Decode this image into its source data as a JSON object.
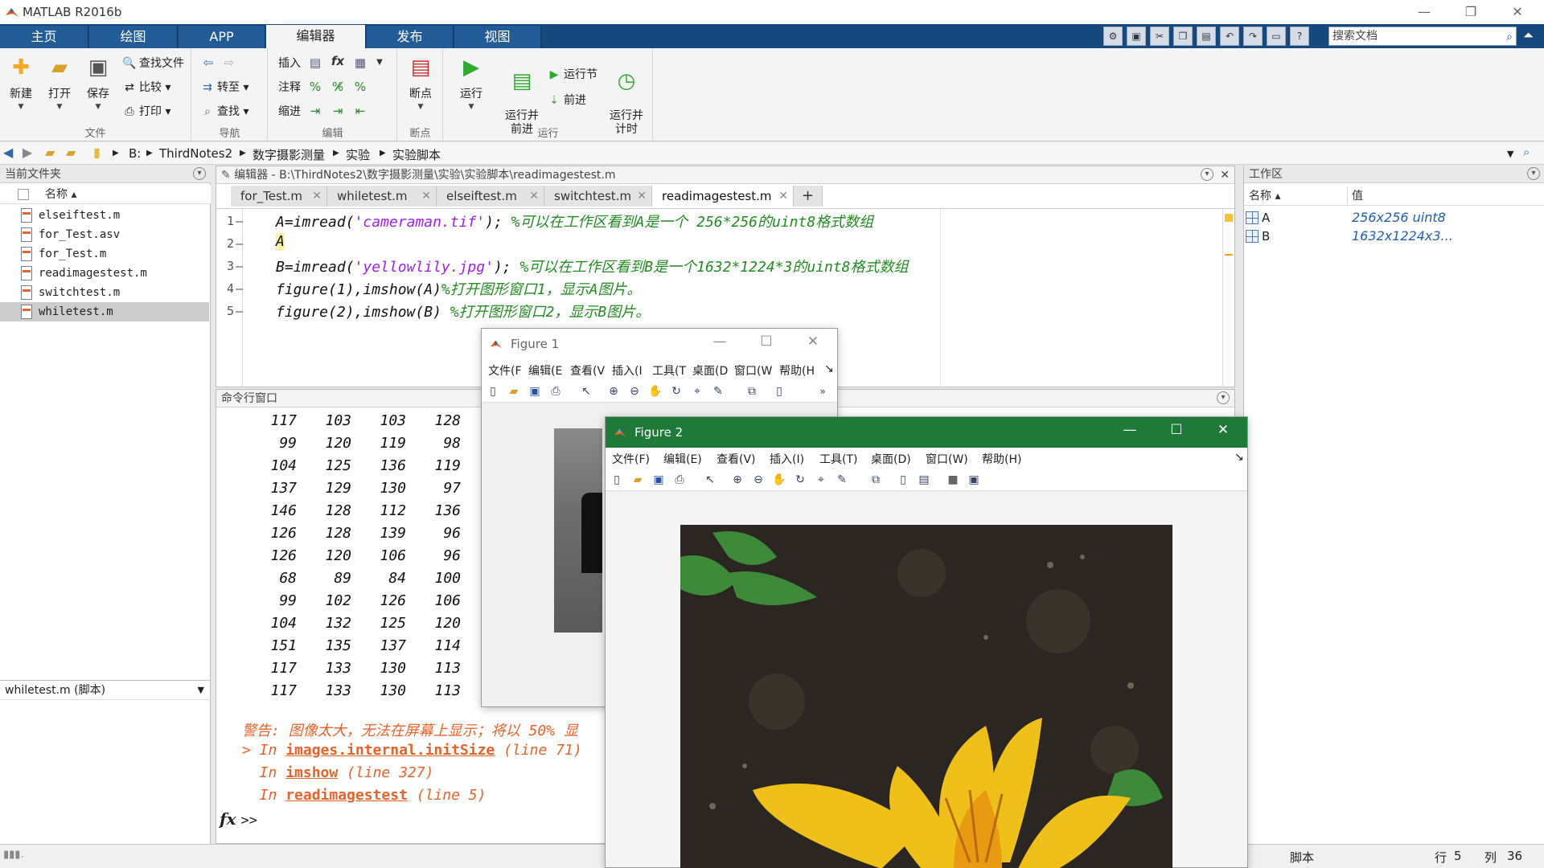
{
  "app": {
    "title": "MATLAB R2016b"
  },
  "window_controls": {
    "minimize": "—",
    "restore": "❐",
    "close": "✕"
  },
  "tabs": [
    "主页",
    "绘图",
    "APP",
    "编辑器",
    "发布",
    "视图"
  ],
  "active_tab": "编辑器",
  "search": {
    "placeholder": "搜索文档"
  },
  "ribbon": {
    "file_group": {
      "label": "文件",
      "new": "新建",
      "open": "打开",
      "save": "保存",
      "find_files": "查找文件",
      "compare": "比较",
      "print": "打印"
    },
    "nav_group": {
      "label": "导航",
      "goto": "转至",
      "find": "查找"
    },
    "edit_group": {
      "label": "编辑",
      "insert": "插入",
      "comment": "注释",
      "indent": "缩进",
      "fx": "fx"
    },
    "breakpoint_group": {
      "label": "断点",
      "breakpoints": "断点"
    },
    "run_group": {
      "label": "运行",
      "run": "运行",
      "run_advance": "运行并\n前进",
      "run_section": "运行节",
      "advance": "前进",
      "run_time": "运行并\n计时"
    }
  },
  "address": {
    "crumbs": [
      "B:",
      "ThirdNotes2",
      "数字摄影测量",
      "实验",
      "实验脚本"
    ]
  },
  "current_folder": {
    "title": "当前文件夹",
    "column": "名称 ▴",
    "files": [
      "elseiftest.m",
      "for_Test.asv",
      "for_Test.m",
      "readimagestest.m",
      "switchtest.m",
      "whiletest.m"
    ],
    "selected": "whiletest.m",
    "detail_label": "whiletest.m  (脚本)"
  },
  "editor": {
    "title": "编辑器 - B:\\ThirdNotes2\\数字摄影测量\\实验\\实验脚本\\readimagestest.m",
    "tabs": [
      "for_Test.m",
      "whiletest.m",
      "elseiftest.m",
      "switchtest.m",
      "readimagestest.m"
    ],
    "active_tab": "readimagestest.m",
    "add_tab": "+",
    "lines": [
      {
        "no": "1",
        "a": "A=imread(",
        "s": "'cameraman.tif'",
        "b": "); ",
        "c": "%可以在工作区看到A是一个 256*256的uint8格式数组"
      },
      {
        "no": "2",
        "a": "A",
        "s": "",
        "b": "",
        "c": ""
      },
      {
        "no": "3",
        "a": "B=imread(",
        "s": "'yellowlily.jpg'",
        "b": "); ",
        "c": "%可以在工作区看到B是一个1632*1224*3的uint8格式数组"
      },
      {
        "no": "4",
        "a": "figure(1),imshow(A)",
        "s": "",
        "b": "",
        "c": "%打开图形窗口1，显示A图片。"
      },
      {
        "no": "5",
        "a": "figure(2),imshow(B) ",
        "s": "",
        "b": "",
        "c": "%打开图形窗口2，显示B图片。"
      }
    ]
  },
  "command_window": {
    "title": "命令行窗口",
    "rows": [
      [
        "117",
        "103",
        "103",
        "128"
      ],
      [
        "99",
        "120",
        "119",
        "98"
      ],
      [
        "104",
        "125",
        "136",
        "119"
      ],
      [
        "137",
        "129",
        "130",
        "97"
      ],
      [
        "146",
        "128",
        "112",
        "136"
      ],
      [
        "126",
        "128",
        "139",
        "96"
      ],
      [
        "126",
        "120",
        "106",
        "96"
      ],
      [
        "68",
        "89",
        "84",
        "100"
      ],
      [
        "99",
        "102",
        "126",
        "106"
      ],
      [
        "104",
        "132",
        "125",
        "120"
      ],
      [
        "151",
        "135",
        "137",
        "114"
      ],
      [
        "117",
        "133",
        "130",
        "113"
      ],
      [
        "117",
        "133",
        "130",
        "113"
      ]
    ],
    "warning": "警告: 图像太大，无法在屏幕上显示；将以 50% 显",
    "trace": [
      {
        "prefix": "> In ",
        "fn": "images.internal.initSize",
        "loc": " (line 71)"
      },
      {
        "prefix": "  In ",
        "fn": "imshow",
        "loc": " (line 327)"
      },
      {
        "prefix": "  In ",
        "fn": "readimagestest",
        "loc": " (line 5)"
      }
    ],
    "prompt": ">>",
    "fx": "fx"
  },
  "workspace": {
    "title": "工作区",
    "col_name": "名称 ▴",
    "col_value": "值",
    "vars": [
      {
        "name": "A",
        "value": "256x256 uint8"
      },
      {
        "name": "B",
        "value": "1632x1224x3..."
      }
    ]
  },
  "status": {
    "type": "脚本",
    "row_label": "行",
    "row": "5",
    "col_label": "列",
    "col": "36"
  },
  "figure1": {
    "title": "Figure 1",
    "menu": [
      "文件(F",
      "编辑(E",
      "查看(V",
      "插入(I",
      "工具(T",
      "桌面(D",
      "窗口(W",
      "帮助(H"
    ],
    "more": "»"
  },
  "figure2": {
    "title": "Figure 2",
    "menu": [
      "文件(F)",
      "编辑(E)",
      "查看(V)",
      "插入(I)",
      "工具(T)",
      "桌面(D)",
      "窗口(W)",
      "帮助(H)"
    ]
  },
  "colors": {
    "tab_strip": "#16487e",
    "figure2_title": "#1f7a3a",
    "comment": "#228b22",
    "string": "#a020f0",
    "warning": "#e8632a"
  }
}
